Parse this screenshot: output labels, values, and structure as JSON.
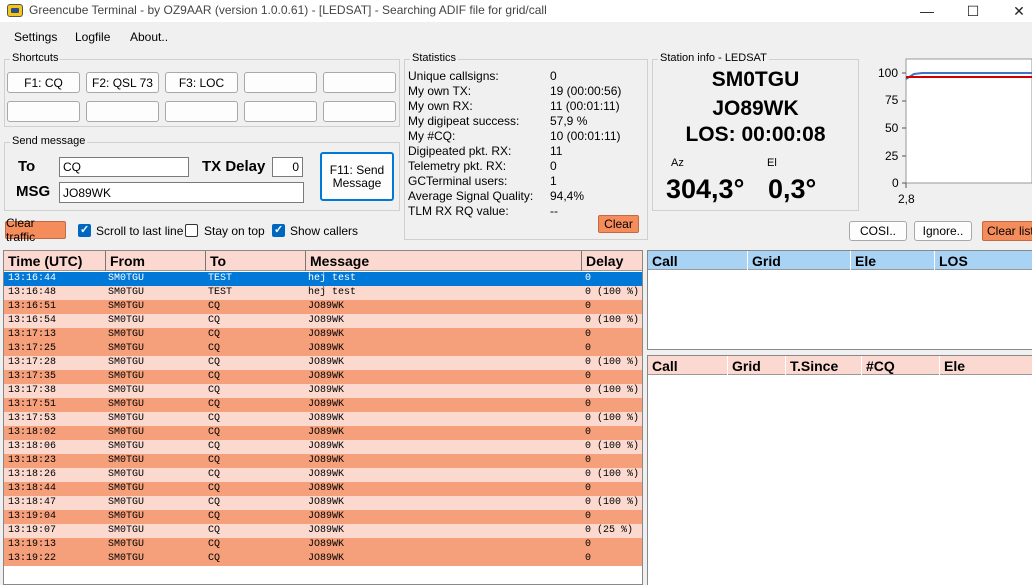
{
  "window": {
    "title": "Greencube Terminal - by OZ9AAR (version 1.0.0.61) - [LEDSAT] - Searching ADIF file for grid/call",
    "minimize": "—",
    "maximize": "☐",
    "close": "✕"
  },
  "menu": [
    "Settings",
    "Logfile",
    "About.."
  ],
  "shortcuts": {
    "title": "Shortcuts",
    "buttons": [
      "F1: CQ",
      "F2: QSL 73",
      "F3: LOC",
      "",
      "",
      "",
      "",
      "",
      "",
      ""
    ]
  },
  "send_message": {
    "title": "Send message",
    "to_label": "To",
    "to_value": "CQ",
    "tx_delay_label": "TX Delay",
    "tx_delay_value": "0",
    "msg_label": "MSG",
    "msg_value": "JO89WK",
    "send_button": "F11: Send Message"
  },
  "statistics": {
    "title": "Statistics",
    "rows": [
      {
        "label": "Unique callsigns:",
        "value": "0"
      },
      {
        "label": "My own TX:",
        "value": "19  (00:00:56)"
      },
      {
        "label": "My own RX:",
        "value": "11  (00:01:11)"
      },
      {
        "label": "My digipeat success:",
        "value": "57,9 %"
      },
      {
        "label": "My #CQ:",
        "value": "10  (00:01:11)"
      },
      {
        "label": "Digipeated pkt. RX:",
        "value": "11"
      },
      {
        "label": "Telemetry pkt. RX:",
        "value": "0"
      },
      {
        "label": "GCTerminal users:",
        "value": "1"
      },
      {
        "label": "Average Signal Quality:",
        "value": "94,4%"
      },
      {
        "label": "TLM RX RQ value:",
        "value": "--"
      }
    ],
    "clear_button": "Clear"
  },
  "station": {
    "title": "Station info - LEDSAT",
    "callsign": "SM0TGU",
    "grid": "JO89WK",
    "los": "LOS: 00:00:08",
    "az_label": "Az",
    "el_label": "El",
    "az_value": "304,3°",
    "el_value": "0,3°"
  },
  "mini_chart": {
    "y_ticks": [
      "100",
      "75",
      "50",
      "25",
      "0"
    ],
    "x_tick": "2,8",
    "colors": {
      "blue": "#4472c4",
      "red": "#d00000"
    }
  },
  "right_buttons": [
    "COSI..",
    "Ignore..",
    "Clear lists"
  ],
  "toolbar": {
    "clear_traffic": "Clear traffic",
    "checkboxes": [
      {
        "label": "Scroll to last line",
        "checked": true
      },
      {
        "label": "Stay on top",
        "checked": false
      },
      {
        "label": "Show callers",
        "checked": true
      }
    ]
  },
  "messages": {
    "columns": [
      "Time (UTC)",
      "From",
      "To",
      "Message",
      "Delay"
    ],
    "rows": [
      {
        "time": "13:16:44",
        "from": "SM0TGU",
        "to": "TEST",
        "msg": "hej test",
        "delay": "0",
        "style": "selected"
      },
      {
        "time": "13:16:48",
        "from": "SM0TGU",
        "to": "TEST",
        "msg": "hej test",
        "delay": "0 (100 %)",
        "style": "light"
      },
      {
        "time": "13:16:51",
        "from": "SM0TGU",
        "to": "CQ",
        "msg": "JO89WK",
        "delay": "0",
        "style": "dark"
      },
      {
        "time": "13:16:54",
        "from": "SM0TGU",
        "to": "CQ",
        "msg": "JO89WK",
        "delay": "0 (100 %)",
        "style": "light"
      },
      {
        "time": "13:17:13",
        "from": "SM0TGU",
        "to": "CQ",
        "msg": "JO89WK",
        "delay": "0",
        "style": "dark"
      },
      {
        "time": "13:17:25",
        "from": "SM0TGU",
        "to": "CQ",
        "msg": "JO89WK",
        "delay": "0",
        "style": "dark"
      },
      {
        "time": "13:17:28",
        "from": "SM0TGU",
        "to": "CQ",
        "msg": "JO89WK",
        "delay": "0 (100 %)",
        "style": "light"
      },
      {
        "time": "13:17:35",
        "from": "SM0TGU",
        "to": "CQ",
        "msg": "JO89WK",
        "delay": "0",
        "style": "dark"
      },
      {
        "time": "13:17:38",
        "from": "SM0TGU",
        "to": "CQ",
        "msg": "JO89WK",
        "delay": "0 (100 %)",
        "style": "light"
      },
      {
        "time": "13:17:51",
        "from": "SM0TGU",
        "to": "CQ",
        "msg": "JO89WK",
        "delay": "0",
        "style": "dark"
      },
      {
        "time": "13:17:53",
        "from": "SM0TGU",
        "to": "CQ",
        "msg": "JO89WK",
        "delay": "0 (100 %)",
        "style": "light"
      },
      {
        "time": "13:18:02",
        "from": "SM0TGU",
        "to": "CQ",
        "msg": "JO89WK",
        "delay": "0",
        "style": "dark"
      },
      {
        "time": "13:18:06",
        "from": "SM0TGU",
        "to": "CQ",
        "msg": "JO89WK",
        "delay": "0 (100 %)",
        "style": "light"
      },
      {
        "time": "13:18:23",
        "from": "SM0TGU",
        "to": "CQ",
        "msg": "JO89WK",
        "delay": "0",
        "style": "dark"
      },
      {
        "time": "13:18:26",
        "from": "SM0TGU",
        "to": "CQ",
        "msg": "JO89WK",
        "delay": "0 (100 %)",
        "style": "light"
      },
      {
        "time": "13:18:44",
        "from": "SM0TGU",
        "to": "CQ",
        "msg": "JO89WK",
        "delay": "0",
        "style": "dark"
      },
      {
        "time": "13:18:47",
        "from": "SM0TGU",
        "to": "CQ",
        "msg": "JO89WK",
        "delay": "0 (100 %)",
        "style": "light"
      },
      {
        "time": "13:19:04",
        "from": "SM0TGU",
        "to": "CQ",
        "msg": "JO89WK",
        "delay": "0",
        "style": "dark"
      },
      {
        "time": "13:19:07",
        "from": "SM0TGU",
        "to": "CQ",
        "msg": "JO89WK",
        "delay": "0 (25 %)",
        "style": "light"
      },
      {
        "time": "13:19:13",
        "from": "SM0TGU",
        "to": "CQ",
        "msg": "JO89WK",
        "delay": "0",
        "style": "dark"
      },
      {
        "time": "13:19:22",
        "from": "SM0TGU",
        "to": "CQ",
        "msg": "JO89WK",
        "delay": "0",
        "style": "dark"
      }
    ]
  },
  "callers_grid": {
    "columns": [
      "Call",
      "Grid",
      "Ele",
      "LOS"
    ]
  },
  "cq_grid": {
    "columns": [
      "Call",
      "Grid",
      "T.Since",
      "#CQ",
      "Ele"
    ]
  },
  "colors": {
    "row_dark": "#f5a07a",
    "row_light": "#fbd9cf",
    "row_selected": "#0078d7",
    "header_blue": "#a9d3f5",
    "header_pink": "#fbd9d0",
    "accent_orange": "#f58c5b"
  }
}
